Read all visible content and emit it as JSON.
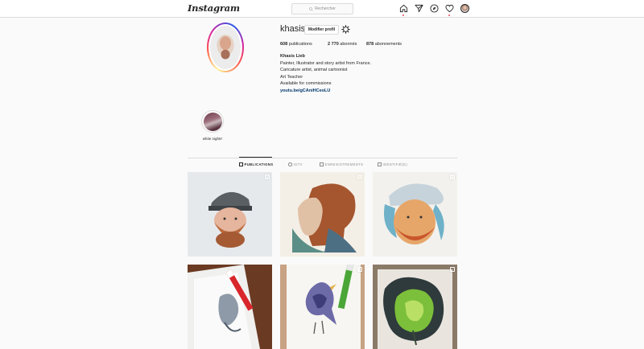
{
  "topbar": {
    "logo": "Instagram",
    "search_placeholder": "Rechercher"
  },
  "profile": {
    "username": "khasis",
    "edit_label": "Modifier profil",
    "stats": {
      "posts_count": "608",
      "posts_label": " publications",
      "followers_count": "2 770",
      "followers_label": " abonnés",
      "following_count": "878",
      "following_label": " abonnements"
    },
    "bio": {
      "name": "Khasis Lieb",
      "lines": [
        "Painter, Illustrator and story artist from France.",
        "Caricature artist, animal cartoonist",
        "Art Teacher",
        "Available for commissions"
      ],
      "link": "youtu.be/gCAniHCeoLU"
    }
  },
  "highlights": [
    {
      "label": "white nights'"
    }
  ],
  "tabs": [
    {
      "label": "PUBLICATIONS",
      "icon": "grid-icon",
      "active": true
    },
    {
      "label": "IGTV",
      "icon": "igtv-icon",
      "active": false
    },
    {
      "label": "ENREGISTREMENTS",
      "icon": "bookmark-icon",
      "active": false
    },
    {
      "label": "IDENTIFIÉ(E)",
      "icon": "tag-icon",
      "active": false
    }
  ],
  "posts": [
    {
      "subject": "watercolor-man-with-cap-and-beard",
      "multi": true
    },
    {
      "subject": "watercolor-woman-profile-red-hair",
      "multi": true
    },
    {
      "subject": "watercolor-bearded-man-with-cap",
      "multi": true
    },
    {
      "subject": "sketchbook-drawing-with-red-marker",
      "multi": false
    },
    {
      "subject": "bird-illustration-with-green-pen",
      "multi": true
    },
    {
      "subject": "green-fruit-painting",
      "multi": true
    }
  ],
  "colors": {
    "link": "#00376b",
    "notification_dot": "#ed4956",
    "border": "#dbdbdb",
    "background": "#fafafa"
  }
}
